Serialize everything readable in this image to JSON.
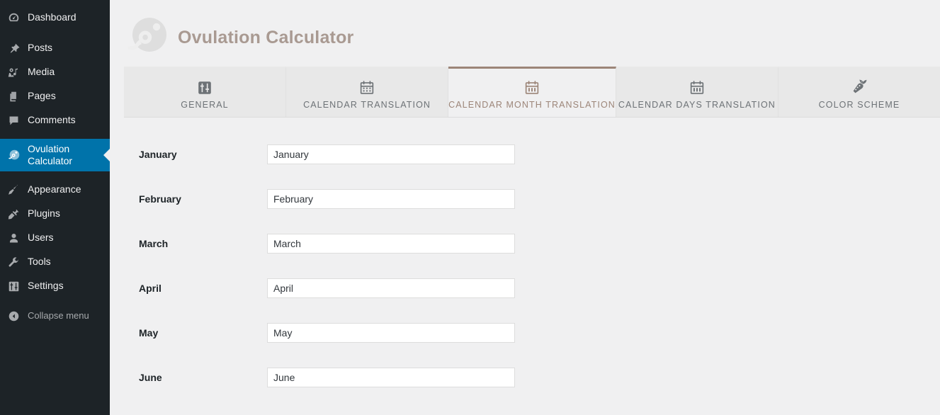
{
  "sidebar": {
    "items": [
      {
        "label": "Dashboard",
        "icon": "dashboard-gauge-icon",
        "state": "default"
      },
      {
        "label": "Posts",
        "icon": "pin-icon",
        "state": "default"
      },
      {
        "label": "Media",
        "icon": "media-icon",
        "state": "default"
      },
      {
        "label": "Pages",
        "icon": "pages-icon",
        "state": "default"
      },
      {
        "label": "Comments",
        "icon": "comment-bubble-icon",
        "state": "default"
      },
      {
        "label": "Ovulation Calculator",
        "icon": "ovulation-egg-icon",
        "state": "active"
      },
      {
        "label": "Appearance",
        "icon": "paintbrush-icon",
        "state": "default"
      },
      {
        "label": "Plugins",
        "icon": "plug-icon",
        "state": "default"
      },
      {
        "label": "Users",
        "icon": "user-icon",
        "state": "default"
      },
      {
        "label": "Tools",
        "icon": "wrench-icon",
        "state": "default"
      },
      {
        "label": "Settings",
        "icon": "sliders-icon",
        "state": "default"
      },
      {
        "label": "Collapse menu",
        "icon": "collapse-arrow-icon",
        "state": "collapse"
      }
    ],
    "active_background": "#0073aa",
    "background": "#1d2327"
  },
  "header": {
    "title": "Ovulation Calculator",
    "logo_icon": "ovulation-egg-sperm-logo",
    "title_color": "#a99a92"
  },
  "tabs": [
    {
      "label": "GENERAL",
      "icon": "sliders-square-icon",
      "active": false
    },
    {
      "label": "CALENDAR TRANSLATION",
      "icon": "calendar-dots-icon",
      "active": false
    },
    {
      "label": "CALENDAR MONTH TRANSLATION",
      "icon": "calendar-bars-icon",
      "active": true
    },
    {
      "label": "CALENDAR DAYS TRANSLATION",
      "icon": "calendar-bars-icon",
      "active": false
    },
    {
      "label": "COLOR SCHEME",
      "icon": "carrot-icon",
      "active": false
    }
  ],
  "accent_color": "#9c8578",
  "form": {
    "rows": [
      {
        "label": "January",
        "value": "January"
      },
      {
        "label": "February",
        "value": "February"
      },
      {
        "label": "March",
        "value": "March"
      },
      {
        "label": "April",
        "value": "April"
      },
      {
        "label": "May",
        "value": "May"
      },
      {
        "label": "June",
        "value": "June"
      }
    ]
  }
}
